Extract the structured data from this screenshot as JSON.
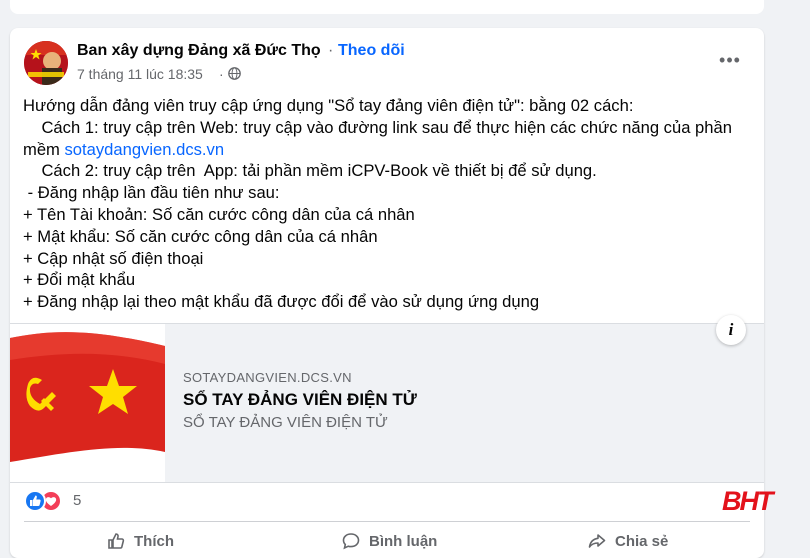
{
  "post": {
    "author": "Ban xây dựng Đảng xã Đức Thọ",
    "separator": "·",
    "follow_label": "Theo dõi",
    "timestamp": "7 tháng 11 lúc 18:35",
    "timestamp_separator": "·",
    "more_label": "•••",
    "body": {
      "line1": "Hướng dẫn đảng viên truy cập ứng dụng \"Sổ tay đảng viên điện tử\": bằng 02 cách:",
      "line2": "    Cách 1: truy cập trên Web: truy cập vào đường link sau để thực hiện các chức năng của phần",
      "line3_prefix": "mềm ",
      "line3_link": "sotaydangvien.dcs.vn",
      "line4": "    Cách 2: truy cập trên  App: tải phần mềm iCPV-Book về thiết bị để sử dụng.",
      "line5": " - Đăng nhập lần đầu tiên như sau:",
      "line6": "+ Tên Tài khoản: Số căn cước công dân của cá nhân",
      "line7": "+ Mật khẩu: Số căn cước công dân của cá nhân",
      "line8": "+ Cập nhật số điện thoại",
      "line9": "+ Đổi mật khẩu",
      "line10": "+ Đăng nhập lại theo mật khẩu đã được đổi để vào sử dụng ứng dụng"
    },
    "link_preview": {
      "domain": "SOTAYDANGVIEN.DCS.VN",
      "title": "SỔ TAY ĐẢNG VIÊN ĐIỆN TỬ",
      "description": "SỔ TAY ĐẢNG VIÊN ĐIỆN TỬ",
      "info_label": "i"
    },
    "reactions": {
      "count": "5"
    },
    "actions": {
      "like": "Thích",
      "comment": "Bình luận",
      "share": "Chia sẻ"
    }
  },
  "watermark": "BHT",
  "colors": {
    "accent": "#0866ff",
    "secondary_text": "#65676b",
    "flag_red": "#da251d",
    "flag_yellow": "#ffde00",
    "watermark_red": "#e3121b"
  }
}
